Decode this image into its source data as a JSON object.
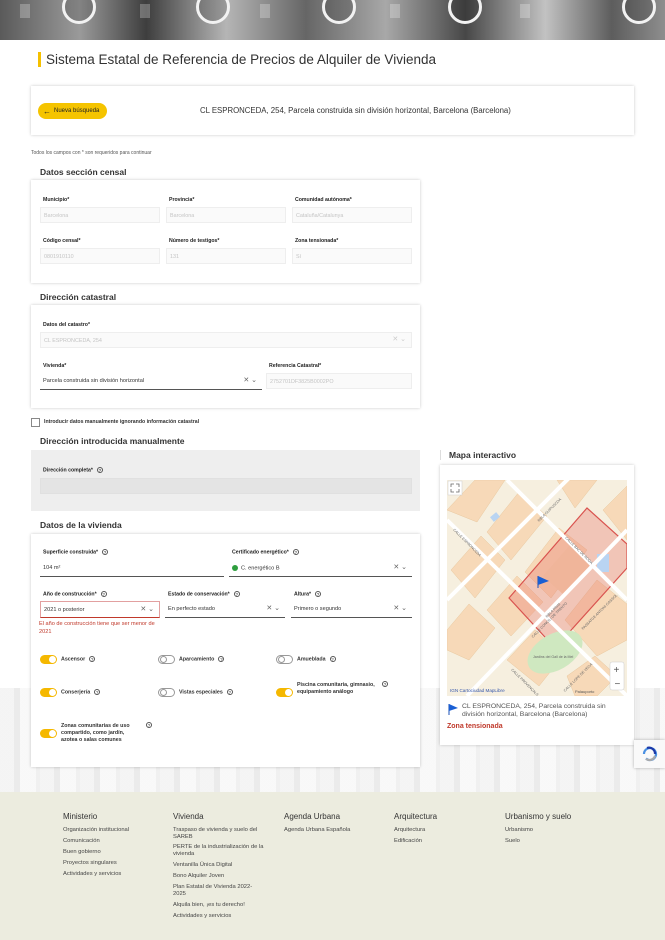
{
  "page_title": "Sistema Estatal de Referencia de Precios de Alquiler de Vivienda",
  "search_bar": {
    "new_search_label": "Nueva búsqueda",
    "address": "CL ESPRONCEDA, 254, Parcela construida sin división horizontal, Barcelona (Barcelona)"
  },
  "required_note": "Todos los campos con * son requeridos para continuar",
  "censal": {
    "title": "Datos sección censal",
    "municipio_label": "Municipio*",
    "municipio_value": "Barcelona",
    "provincia_label": "Provincia*",
    "provincia_value": "Barcelona",
    "comunidad_label": "Comunidad autónoma*",
    "comunidad_value": "Cataluña/Catalunya",
    "codigo_label": "Código censal*",
    "codigo_value": "0801910110",
    "testigos_label": "Número de testigos*",
    "testigos_value": "131",
    "zona_label": "Zona tensionada*",
    "zona_value": "Sí"
  },
  "catastral": {
    "title": "Dirección catastral",
    "datos_label": "Datos del catastro*",
    "datos_value": "CL ESPRONCEDA, 254",
    "vivienda_label": "Vivienda*",
    "vivienda_value": "Parcela construida sin división horizontal",
    "ref_label": "Referencia Catastral*",
    "ref_value": "2752701DF3825B0002PO"
  },
  "manual_checkbox_label": "Introducir datos manualmente ignorando información catastral",
  "manual": {
    "title": "Dirección introducida manualmente",
    "direccion_label": "Dirección completa*"
  },
  "vivienda": {
    "title": "Datos de la vivienda",
    "superficie_label": "Superficie construida*",
    "superficie_value": "104  m²",
    "certificado_label": "Certificado energético*",
    "certificado_value": "C. energético B",
    "certificado_color": "#2e9e3e",
    "ano_label": "Año de construcción*",
    "ano_value": "2021 o posterior",
    "ano_error": "El año de construcción tiene que ser menor de 2021",
    "estado_label": "Estado de conservación*",
    "estado_value": "En perfecto estado",
    "altura_label": "Altura*",
    "altura_value": "Primero o segundo",
    "toggles": [
      {
        "label": "Ascensor",
        "on": true
      },
      {
        "label": "Aparcamiento",
        "on": false
      },
      {
        "label": "Amueblada",
        "on": false
      },
      {
        "label": "Conserjería",
        "on": true
      },
      {
        "label": "Vistas especiales",
        "on": false
      },
      {
        "label": "Piscina comunitaria, gimnasio, equipamiento análogo",
        "on": true
      },
      {
        "label": "Zonas comunitarias de uso compartido, como jardín, azotea o salas comunes",
        "on": true
      }
    ]
  },
  "map": {
    "title": "Mapa interactivo",
    "streets": [
      "CALLE ESPRONCEDA",
      "RBLA GUIPUSCOA",
      "CALLE BAC DE RODA",
      "CALLE CONCILI DE TRENTO",
      "RBLA PRIM",
      "PASSATGE ANTONI GASSOL",
      "CALLE PROVENÇALS",
      "CALLE LOPE DE VEGA",
      "Jardins del Gall de la Mel"
    ],
    "attribution": "IGN Cartociudad MapLibre",
    "poi": "Palauporto",
    "legend_text": "CL ESPRONCEDA, 254, Parcela construida sin división horizontal, Barcelona (Barcelona)",
    "zone_text": "Zona tensionada",
    "zone_color": "#c0392b"
  },
  "footer": {
    "columns": [
      {
        "title": "Ministerio",
        "links": [
          "Organización institucional",
          "Comunicación",
          "Buen gobierno",
          "Proyectos singulares",
          "Actividades y servicios"
        ]
      },
      {
        "title": "Vivienda",
        "links": [
          "Traspaso de vivienda y suelo del SAREB",
          "PERTE de la industrialización de la vivienda",
          "Ventanilla Única Digital",
          "Bono Alquiler Joven",
          "Plan Estatal de Vivienda 2022-2025",
          "Alquila bien, ¡es tu derecho!",
          "Actividades y servicios"
        ]
      },
      {
        "title": "Agenda Urbana",
        "links": [
          "Agenda Urbana Española"
        ]
      },
      {
        "title": "Arquitectura",
        "links": [
          "Arquitectura",
          "Edificación"
        ]
      },
      {
        "title": "Urbanismo y suelo",
        "links": [
          "Urbanismo",
          "Suelo"
        ]
      }
    ]
  },
  "accent_color": "#f5c400"
}
